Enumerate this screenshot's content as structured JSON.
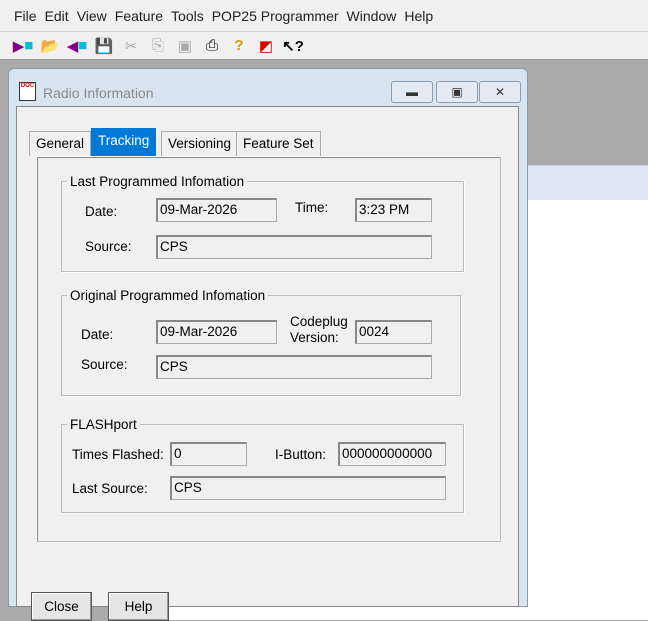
{
  "menu": [
    "File",
    "Edit",
    "View",
    "Feature",
    "Tools",
    "POP25 Programmer",
    "Window",
    "Help"
  ],
  "toolbar": [
    "read-radio-icon",
    "open-folder-icon",
    "write-radio-icon",
    "save-icon",
    "cut-icon",
    "copy-icon",
    "paste-icon",
    "print-icon",
    "help-icon",
    "wizard-icon",
    "context-help-icon"
  ],
  "dialog": {
    "title": "Radio Information",
    "tabs": [
      "General",
      "Tracking",
      "Versioning",
      "Feature Set"
    ],
    "last": {
      "title": "Last Programmed Infomation",
      "date_label": "Date:",
      "date": "09-Mar-2026",
      "time_label": "Time:",
      "time": "3:23 PM",
      "source_label": "Source:",
      "source": "CPS"
    },
    "original": {
      "title": "Original Programmed Infomation",
      "date_label": "Date:",
      "date": "09-Mar-2026",
      "codeplug_label1": "Codeplug",
      "codeplug_label2": "Version:",
      "codeplug": "0024",
      "source_label": "Source:",
      "source": "CPS"
    },
    "flash": {
      "title": "FLASHport",
      "times_label": "Times Flashed:",
      "times": "0",
      "ibutton_label": "I-Button:",
      "ibutton": "000000000000",
      "last_source_label": "Last Source:",
      "last_source": "CPS"
    },
    "close": "Close",
    "help": "Help"
  }
}
